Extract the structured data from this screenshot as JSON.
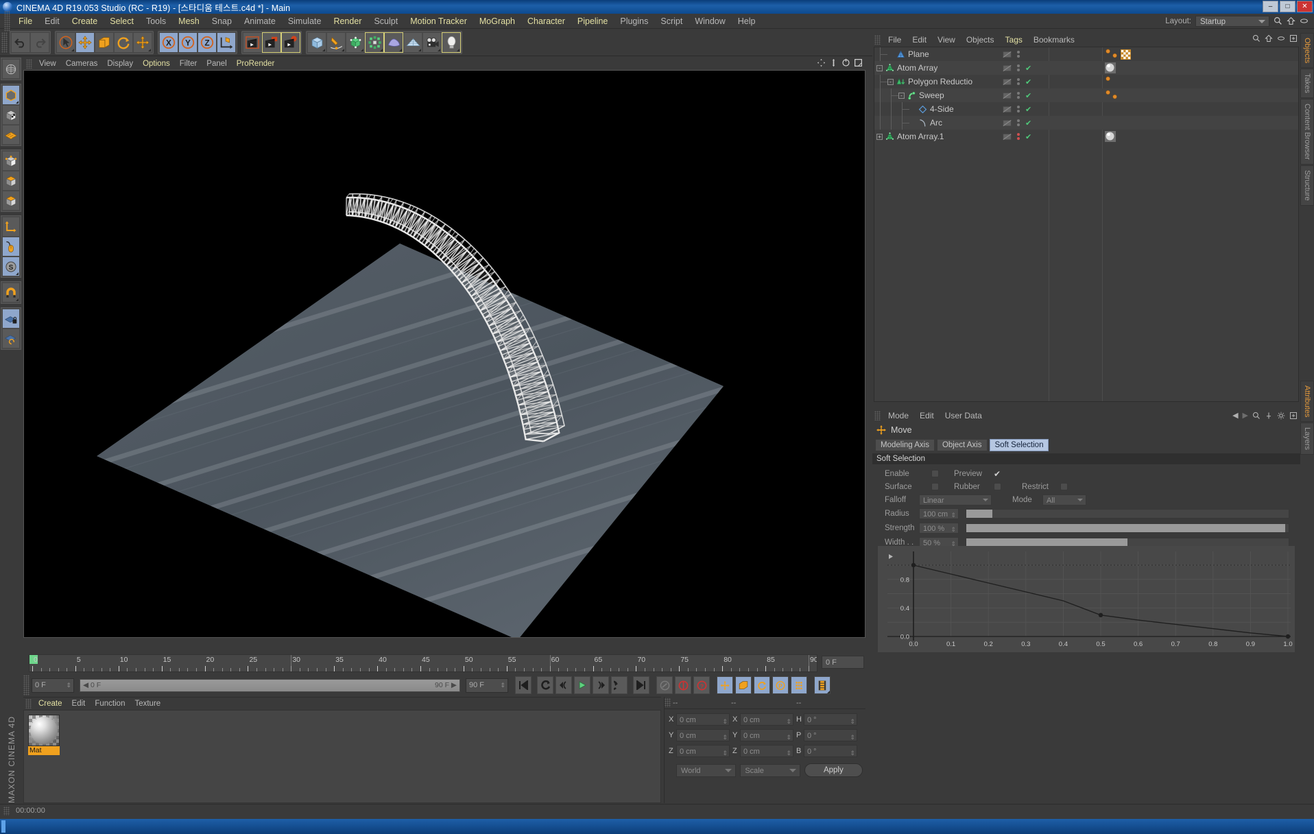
{
  "window": {
    "title": "CINEMA 4D R19.053 Studio (RC - R19) - [스타디움 테스트.c4d *] - Main",
    "minimize": "–",
    "maximize": "□",
    "close": "✕"
  },
  "menubar": {
    "items": [
      {
        "label": "File",
        "hl": false
      },
      {
        "label": "Edit",
        "hl": false
      },
      {
        "label": "Create",
        "hl": true
      },
      {
        "label": "Select",
        "hl": true
      },
      {
        "label": "Tools",
        "hl": false
      },
      {
        "label": "Mesh",
        "hl": true
      },
      {
        "label": "Snap",
        "hl": false
      },
      {
        "label": "Animate",
        "hl": false
      },
      {
        "label": "Simulate",
        "hl": false
      },
      {
        "label": "Render",
        "hl": true
      },
      {
        "label": "Sculpt",
        "hl": false
      },
      {
        "label": "Motion Tracker",
        "hl": true
      },
      {
        "label": "MoGraph",
        "hl": true
      },
      {
        "label": "Character",
        "hl": true
      },
      {
        "label": "Pipeline",
        "hl": true
      },
      {
        "label": "Plugins",
        "hl": false
      },
      {
        "label": "Script",
        "hl": false
      },
      {
        "label": "Window",
        "hl": false
      },
      {
        "label": "Help",
        "hl": false
      }
    ]
  },
  "layout": {
    "label": "Layout:",
    "value": "Startup"
  },
  "toolbar": {
    "undo": "undo",
    "redo": "redo",
    "tools": [
      "live-selection",
      "move",
      "scale",
      "rotate",
      "move-axis"
    ],
    "axes": [
      "X",
      "Y",
      "Z"
    ],
    "axis_world": "world-coordinate-system",
    "render": [
      "render-view",
      "render-region",
      "render-settings"
    ],
    "objects": [
      "cube-primitive",
      "pen-spline",
      "nurbs-generator",
      "array-generator",
      "deformer",
      "scene-floor",
      "camera",
      "light"
    ]
  },
  "left_tools": [
    "world-object-axis",
    "point-mode",
    "edge-mode",
    "polygon-mode",
    "model-mode",
    "object-mode",
    "texture-mode",
    "axis-modification",
    "enable-snapping",
    "workplane-lock",
    "magnet-tool",
    "lock-workplane",
    "workplane-rotate"
  ],
  "viewport": {
    "menu": [
      {
        "label": "View",
        "hl": false
      },
      {
        "label": "Cameras",
        "hl": false
      },
      {
        "label": "Display",
        "hl": false
      },
      {
        "label": "Options",
        "hl": true
      },
      {
        "label": "Filter",
        "hl": false
      },
      {
        "label": "Panel",
        "hl": false
      },
      {
        "label": "ProRender",
        "hl": true
      }
    ],
    "icons": [
      "move-view-icon",
      "pan-view-icon",
      "rotate-view-icon",
      "maximize-view-icon"
    ],
    "scene_description": "Perspective view: dark plane with ribbed surface and a curved white lattice truss arch"
  },
  "timeline": {
    "start_field": "0 F",
    "end_field_right": "0 F",
    "range_left": "0 F",
    "range_right": "90 F",
    "max_field": "90 F",
    "current_frame": 0,
    "ticks": [
      0,
      5,
      10,
      15,
      20,
      25,
      30,
      35,
      40,
      45,
      50,
      55,
      60,
      65,
      70,
      75,
      80,
      85,
      90
    ],
    "buttons": [
      "go-to-start",
      "go-to-previous-frame",
      "step-back",
      "play",
      "step-forward",
      "go-to-next-frame",
      "go-to-end",
      "record-active-objects",
      "autokeying",
      "keyframe-selection",
      "position-key",
      "scale-key",
      "rotation-key",
      "parameter-key",
      "point-level-animation",
      "timeline-toggle"
    ]
  },
  "material_manager": {
    "menu": [
      {
        "label": "Create",
        "hl": true
      },
      {
        "label": "Edit",
        "hl": false
      },
      {
        "label": "Function",
        "hl": false
      },
      {
        "label": "Texture",
        "hl": false
      }
    ],
    "materials": [
      {
        "name": "Mat"
      }
    ]
  },
  "coordinates": {
    "headers": [
      "--",
      "--",
      "--"
    ],
    "rows": [
      {
        "l1": "X",
        "v1": "0 cm",
        "l2": "X",
        "v2": "0 cm",
        "l3": "H",
        "v3": "0 °"
      },
      {
        "l1": "Y",
        "v1": "0 cm",
        "l2": "Y",
        "v2": "0 cm",
        "l3": "P",
        "v3": "0 °"
      },
      {
        "l1": "Z",
        "v1": "0 cm",
        "l2": "Z",
        "v2": "0 cm",
        "l3": "B",
        "v3": "0 °"
      }
    ],
    "system": "World",
    "mode": "Scale",
    "apply": "Apply"
  },
  "object_manager": {
    "menu": [
      {
        "label": "File",
        "hl": false
      },
      {
        "label": "Edit",
        "hl": false
      },
      {
        "label": "View",
        "hl": false
      },
      {
        "label": "Objects",
        "hl": false
      },
      {
        "label": "Tags",
        "hl": true
      },
      {
        "label": "Bookmarks",
        "hl": false
      }
    ],
    "rows": [
      {
        "name": "Plane",
        "depth": 1,
        "icon": "plane-object-icon",
        "expander": "",
        "visdots": [
          "#7a7a7a",
          "#7a7a7a"
        ],
        "check": false,
        "tags": [
          "material-orange",
          "material-orange",
          "checker-tag"
        ]
      },
      {
        "name": "Atom Array",
        "depth": 0,
        "icon": "atom-array-icon",
        "expander": "-",
        "visdots": [
          "#7a7a7a",
          "#7a7a7a"
        ],
        "check": true,
        "tags": [
          "material-sphere"
        ]
      },
      {
        "name": "Polygon Reductio",
        "depth": 1,
        "icon": "polygon-reduction-icon",
        "expander": "-",
        "visdots": [
          "#7a7a7a",
          "#7a7a7a"
        ],
        "check": true,
        "tags": [
          "material-orange"
        ]
      },
      {
        "name": "Sweep",
        "depth": 2,
        "icon": "sweep-icon",
        "expander": "-",
        "visdots": [
          "#7a7a7a",
          "#7a7a7a"
        ],
        "check": true,
        "tags": [
          "material-orange",
          "material-orange"
        ]
      },
      {
        "name": "4-Side",
        "depth": 3,
        "icon": "four-side-spline-icon",
        "expander": "",
        "visdots": [
          "#7a7a7a",
          "#7a7a7a"
        ],
        "check": true,
        "tags": []
      },
      {
        "name": "Arc",
        "depth": 3,
        "icon": "arc-spline-icon",
        "expander": "",
        "visdots": [
          "#7a7a7a",
          "#7a7a7a"
        ],
        "check": true,
        "tags": []
      },
      {
        "name": "Atom Array.1",
        "depth": 0,
        "icon": "atom-array-icon",
        "expander": "+",
        "visdots": [
          "#d05050",
          "#d05050"
        ],
        "check": true,
        "tags": [
          "material-sphere"
        ]
      }
    ],
    "toolbar_icons": [
      "search-icon",
      "home-icon",
      "eye-icon",
      "new-tab-icon"
    ]
  },
  "attributes": {
    "menu": [
      {
        "label": "Mode"
      },
      {
        "label": "Edit"
      },
      {
        "label": "User Data"
      }
    ],
    "title": "Move",
    "tabs": [
      {
        "label": "Modeling Axis",
        "selected": false
      },
      {
        "label": "Object Axis",
        "selected": false
      },
      {
        "label": "Soft Selection",
        "selected": true
      }
    ],
    "section": "Soft Selection",
    "fields": {
      "enable_label": "Enable",
      "enable_checked": false,
      "preview_label": "Preview",
      "preview_checked": true,
      "surface_label": "Surface",
      "surface_checked": false,
      "rubber_label": "Rubber",
      "rubber_checked": false,
      "restrict_label": "Restrict",
      "restrict_checked": false,
      "falloff_label": "Falloff",
      "falloff_value": "Linear",
      "mode_label": "Mode",
      "mode_value": "All",
      "radius_label": "Radius",
      "radius_value": "100 cm",
      "radius_fill": 8,
      "strength_label": "Strength",
      "strength_value": "100 %",
      "strength_fill": 99,
      "width_label": "Width . .",
      "width_value": "50 %",
      "width_fill": 50
    },
    "toolbar_icons": [
      "back-arrow-icon",
      "forward-arrow-icon",
      "search-icon",
      "pin-icon",
      "gear-icon",
      "new-tab-icon"
    ]
  },
  "chart_data": {
    "type": "line",
    "title": "Soft Selection Falloff Curve",
    "x": [
      0.0,
      0.1,
      0.2,
      0.3,
      0.4,
      0.5,
      0.6,
      0.7,
      0.8,
      0.9,
      1.0
    ],
    "values": [
      1.0,
      0.875,
      0.75,
      0.625,
      0.5,
      0.3,
      0.23,
      0.17,
      0.11,
      0.05,
      0.0
    ],
    "series": [
      {
        "name": "Falloff",
        "values": [
          1.0,
          0.875,
          0.75,
          0.625,
          0.5,
          0.3,
          0.23,
          0.17,
          0.11,
          0.05,
          0.0
        ]
      }
    ],
    "knots": [
      {
        "x": 0.0,
        "y": 1.0
      },
      {
        "x": 0.5,
        "y": 0.3
      },
      {
        "x": 1.0,
        "y": 0.0
      }
    ],
    "xticks": [
      "0.0",
      "0.1",
      "0.2",
      "0.3",
      "0.4",
      "0.5",
      "0.6",
      "0.7",
      "0.8",
      "0.9",
      "1.0"
    ],
    "yticks": [
      "0.8",
      "0.4",
      "0.0"
    ],
    "xlabel": "",
    "ylabel": "",
    "xlim": [
      0.0,
      1.0
    ],
    "ylim": [
      0.0,
      1.0
    ],
    "grid": true,
    "legend": "none"
  },
  "right_tabs": {
    "upper": [
      {
        "label": "Objects",
        "selected": true
      },
      {
        "label": "Takes",
        "selected": false
      },
      {
        "label": "Content Browser",
        "selected": false
      },
      {
        "label": "Structure",
        "selected": false
      }
    ],
    "lower": [
      {
        "label": "Attributes",
        "selected": true
      },
      {
        "label": "Layers",
        "selected": false
      }
    ]
  },
  "status": {
    "time": "00:00:00",
    "brand": "MAXON CINEMA 4D"
  }
}
